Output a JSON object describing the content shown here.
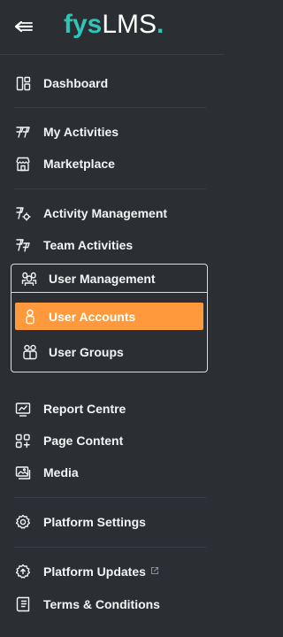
{
  "logo": {
    "brand": "fys",
    "suffix": "LMS",
    "dot": "."
  },
  "colors": {
    "background": "#2b2f33",
    "accent": "#2ec4b6",
    "active": "#ff9a3c",
    "text": "#f3f4f6",
    "border": "#d9dde1"
  },
  "menu": {
    "dashboard": {
      "label": "Dashboard",
      "icon": "dashboard-icon"
    },
    "my_activities": {
      "label": "My Activities",
      "icon": "activities-icon"
    },
    "marketplace": {
      "label": "Marketplace",
      "icon": "store-icon"
    },
    "activity_management": {
      "label": "Activity Management",
      "icon": "activity-management-icon"
    },
    "team_activities": {
      "label": "Team Activities",
      "icon": "team-activities-icon"
    },
    "user_management": {
      "label": "User Management",
      "icon": "users-group-icon",
      "children": [
        {
          "label": "User Accounts",
          "icon": "user-icon",
          "active": true
        },
        {
          "label": "User Groups",
          "icon": "user-groups-icon",
          "active": false
        }
      ]
    },
    "report_centre": {
      "label": "Report Centre",
      "icon": "report-icon"
    },
    "page_content": {
      "label": "Page Content",
      "icon": "page-content-icon"
    },
    "media": {
      "label": "Media",
      "icon": "media-icon"
    },
    "platform_settings": {
      "label": "Platform Settings",
      "icon": "settings-icon"
    },
    "platform_updates": {
      "label": "Platform Updates",
      "icon": "updates-icon",
      "external": true
    },
    "terms_conditions": {
      "label": "Terms & Conditions",
      "icon": "terms-icon"
    }
  }
}
